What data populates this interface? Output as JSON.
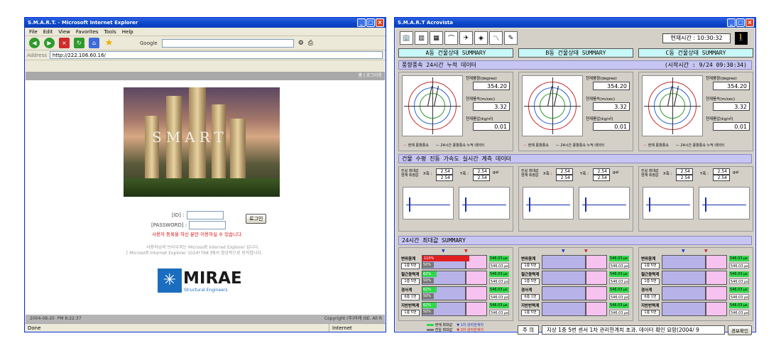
{
  "ie": {
    "title": "S.M.A.R.T. - Microsoft Internet Explorer",
    "menu": [
      "File",
      "Edit",
      "View",
      "Favorites",
      "Tools",
      "Help"
    ],
    "google_label": "Google",
    "address_label": "Address",
    "url": "http://222.106.60.16/",
    "topnav": "홈 | 로그아웃",
    "hero_word": "SMART",
    "id_label": "[ID] :",
    "pw_label": "[PASSWORD] :",
    "login_button": "로그인",
    "register_notice": "사용자 등록을 하신 분만 이용하실 수 있습니다.",
    "browser_note_1": "사용자님의 브라우저는 Microsoft Internet Explorer 입니다.",
    "browser_note_2": "[ Microsoft Internet Explorer 1024*768 ]에서 정상적으로 동작합니다.",
    "logo_text": "MIRAE",
    "logo_sub": "Structural Engineers",
    "footer_date": "2004-08-20",
    "footer_time": "PM   8:22:37",
    "copyright": "Copyright (주)미래 ISE. All R",
    "status_left": "Done",
    "status_zone": "Internet"
  },
  "ac": {
    "title": "S.M.A.R.T Acrovista",
    "clock_label": "현재시간 : 10:30:32",
    "summary_a": "A동 건물상태 SUMMARY",
    "summary_b": "B동 건물상태 SUMMARY",
    "summary_c": "C동 건물상태 SUMMARY",
    "wind_title": "풍향풍속 24시간 누적 데이터",
    "wind_start": "(시작시간 : 9/24 09:30:34)",
    "dir_label": "현재풍향(degree)",
    "speed_label": "현재풍속(m/sec)",
    "pressure_label": "현재풍압(kg/㎡)",
    "dir_value": "354.20",
    "speed_value": "3.32",
    "pressure_value": "0.01",
    "legend_now": "현재 풍향풍속",
    "legend_24": "24시간 풍향풍속 누적 데이터",
    "vib_title": "건물 수평 진동 가속도 실시간 계측 데이터",
    "vib_max": "진실 최대값",
    "vib_now": "현재 측정값",
    "x_axis": "X축 :",
    "y_axis": "Y축 :",
    "vib_val": "2.54",
    "gal": "gal",
    "max24_title": "24시간 최대값 SUMMARY",
    "rows": [
      {
        "name": "변위응계",
        "floor": "1층 5번"
      },
      {
        "name": "철근응력계",
        "floor": "1층 5번"
      },
      {
        "name": "경사계",
        "floor": "6층 1번"
      },
      {
        "name": "지반반력계",
        "floor": "1층 5번"
      }
    ],
    "bar_value": "110%",
    "bar_small": "50%",
    "bar_small2": "62%",
    "micro_value": "546.03 με",
    "legend_current_max": "현재 최대값",
    "legend_past_max": "전일 최대값",
    "legend_limit1": "1차 관리한계치",
    "legend_limit2": "2차 관리한계치",
    "footer_label": "주  의",
    "footer_msg": "지상 1층 5번 센서 1차 관리한계치 초과. 데이터 확인 요망(2004/ 9",
    "confirm_button": "경보확인"
  },
  "colors": {
    "title_blue": "#0a44c8",
    "summary_cyan": "#c8f7f7",
    "section_lavender": "#c7c6f2",
    "badge_green": "#33d74c",
    "alarm_red": "#e02020"
  }
}
